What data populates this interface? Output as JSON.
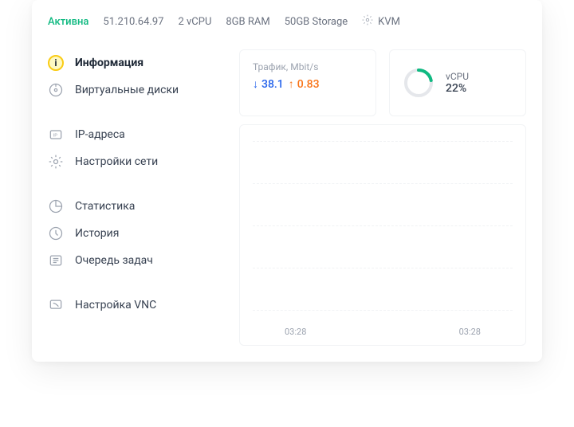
{
  "header": {
    "status": "Активна",
    "ip": "51.210.64.97",
    "cpu": "2 vCPU",
    "ram": "8GB RAM",
    "storage": "50GB Storage",
    "virt": "KVM"
  },
  "sidebar": {
    "groups": [
      [
        {
          "icon": "info",
          "label": "Информация",
          "active": true
        },
        {
          "icon": "disk",
          "label": "Виртуальные диски"
        }
      ],
      [
        {
          "icon": "ip",
          "label": "IP-адреса"
        },
        {
          "icon": "network",
          "label": "Настройки сети"
        }
      ],
      [
        {
          "icon": "stats",
          "label": "Статистика"
        },
        {
          "icon": "history",
          "label": "История"
        },
        {
          "icon": "queue",
          "label": "Очередь задач"
        }
      ],
      [
        {
          "icon": "vnc",
          "label": "Настройка VNC"
        }
      ]
    ]
  },
  "traffic": {
    "label": "Трафик, Mbit/s",
    "down": "38.1",
    "up": "0.83"
  },
  "cpu": {
    "label": "vCPU",
    "percent": "22%",
    "value": 22
  },
  "chart_data": {
    "type": "line",
    "title": "",
    "xlabel": "",
    "ylabel": "",
    "x_ticks": [
      "03:28",
      "03:28"
    ],
    "series": [],
    "grid": true,
    "note": "chart body shows dashed horizontal gridlines only; no plotted series visible"
  }
}
